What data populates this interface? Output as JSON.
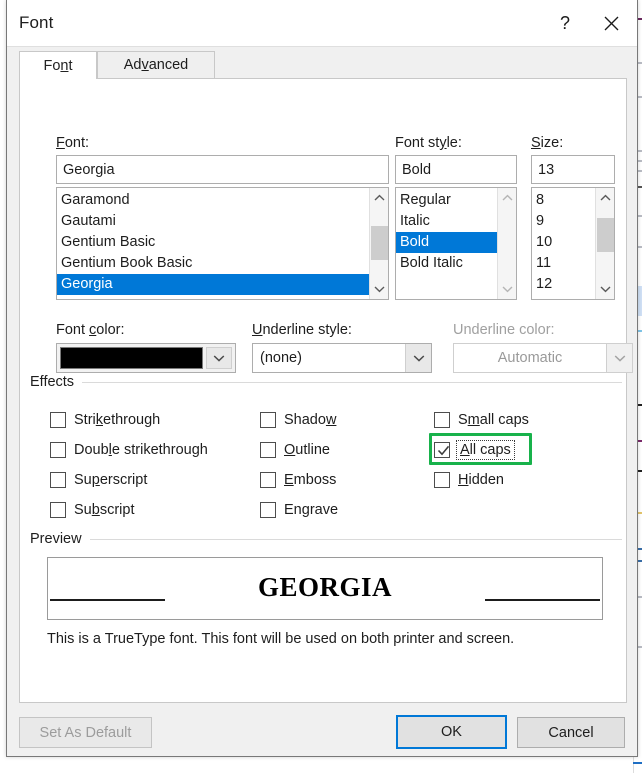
{
  "window": {
    "title": "Font",
    "help_label": "?",
    "close_label": "×"
  },
  "tabs": [
    {
      "label": "Font",
      "active": true
    },
    {
      "label": "Advanced",
      "active": false
    }
  ],
  "font_group": {
    "font_label": "Font:",
    "font_value": "Georgia",
    "font_list": [
      "Garamond",
      "Gautami",
      "Gentium Basic",
      "Gentium Book Basic",
      "Georgia"
    ],
    "font_selected": "Georgia",
    "style_label": "Font style:",
    "style_value": "Bold",
    "style_list": [
      "Regular",
      "Italic",
      "Bold",
      "Bold Italic"
    ],
    "style_selected": "Bold",
    "size_label": "Size:",
    "size_value": "13",
    "size_list": [
      "8",
      "9",
      "10",
      "11",
      "12"
    ],
    "size_selected": ""
  },
  "color_row": {
    "font_color_label": "Font color:",
    "font_color_value": "#000000",
    "underline_style_label": "Underline style:",
    "underline_style_value": "(none)",
    "underline_color_label": "Underline color:",
    "underline_color_value": "Automatic",
    "underline_color_disabled": true
  },
  "effects": {
    "heading": "Effects",
    "items": [
      {
        "label": "Strikethrough",
        "checked": false,
        "col": 0,
        "row": 0
      },
      {
        "label": "Double strikethrough",
        "checked": false,
        "col": 0,
        "row": 1
      },
      {
        "label": "Superscript",
        "checked": false,
        "col": 0,
        "row": 2
      },
      {
        "label": "Subscript",
        "checked": false,
        "col": 0,
        "row": 3
      },
      {
        "label": "Shadow",
        "checked": false,
        "col": 1,
        "row": 0
      },
      {
        "label": "Outline",
        "checked": false,
        "col": 1,
        "row": 1
      },
      {
        "label": "Emboss",
        "checked": false,
        "col": 1,
        "row": 2
      },
      {
        "label": "Engrave",
        "checked": false,
        "col": 1,
        "row": 3
      },
      {
        "label": "Small caps",
        "checked": false,
        "col": 2,
        "row": 0
      },
      {
        "label": "All caps",
        "checked": true,
        "col": 2,
        "row": 1,
        "focused": true,
        "highlight": "#18b24b"
      },
      {
        "label": "Hidden",
        "checked": false,
        "col": 2,
        "row": 2
      }
    ]
  },
  "preview": {
    "heading": "Preview",
    "sample_text": "GEORGIA",
    "note": "This is a TrueType font. This font will be used on both printer and screen."
  },
  "footer": {
    "set_as_default": "Set As Default",
    "ok": "OK",
    "cancel": "Cancel",
    "default_button": "OK",
    "disabled_button": "Set As Default"
  },
  "colors": {
    "selection_blue": "#0078d7",
    "highlight_green": "#18b24b",
    "dialog_bg": "#f0f0f0"
  }
}
